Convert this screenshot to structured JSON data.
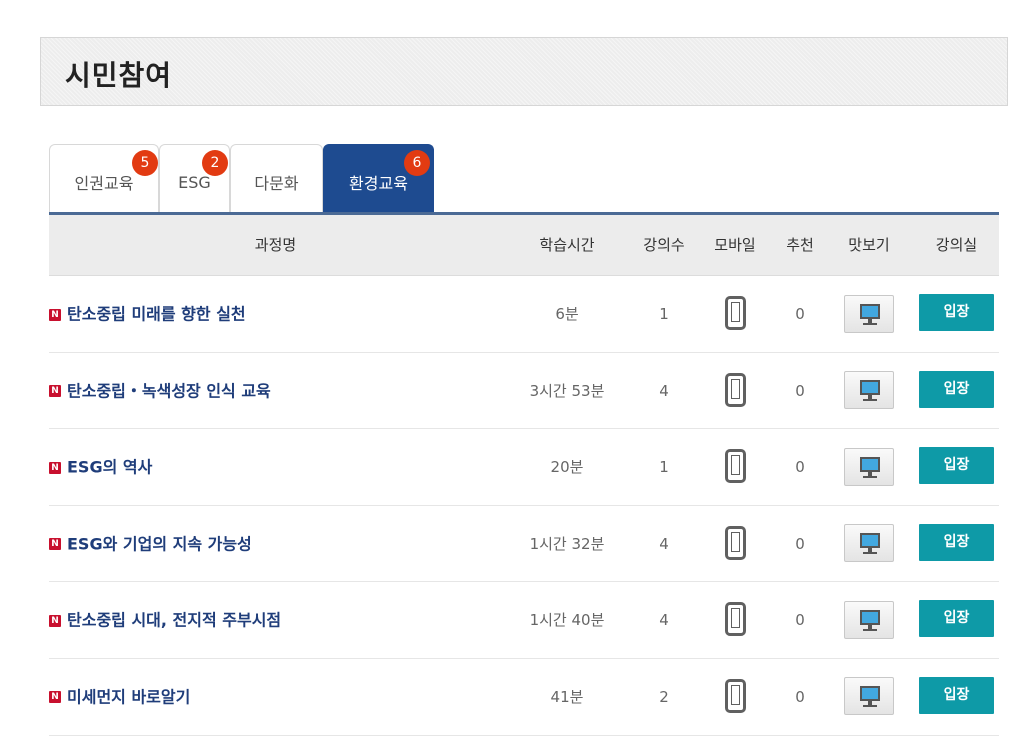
{
  "page": {
    "title": "시민참여"
  },
  "tabs": [
    {
      "label": "인권교육",
      "badge": "5",
      "active": false
    },
    {
      "label": "ESG",
      "badge": "2",
      "active": false
    },
    {
      "label": "다문화",
      "badge": "",
      "active": false
    },
    {
      "label": "환경교육",
      "badge": "6",
      "active": true
    }
  ],
  "table": {
    "headers": {
      "name": "과정명",
      "time": "학습시간",
      "count": "강의수",
      "mobile": "모바일",
      "recommend": "추천",
      "preview": "맛보기",
      "room": "강의실"
    },
    "rows": [
      {
        "new_mark": "N",
        "title": "탄소중립 미래를 향한 실천",
        "time": "6분",
        "count": "1",
        "recommend": "0",
        "enter": "입장"
      },
      {
        "new_mark": "N",
        "title": "탄소중립・녹색성장 인식 교육",
        "time": "3시간 53분",
        "count": "4",
        "recommend": "0",
        "enter": "입장"
      },
      {
        "new_mark": "N",
        "title": "ESG의 역사",
        "time": "20분",
        "count": "1",
        "recommend": "0",
        "enter": "입장"
      },
      {
        "new_mark": "N",
        "title": "ESG와 기업의 지속 가능성",
        "time": "1시간 32분",
        "count": "4",
        "recommend": "0",
        "enter": "입장"
      },
      {
        "new_mark": "N",
        "title": "탄소중립 시대, 전지적 주부시점",
        "time": "1시간 40분",
        "count": "4",
        "recommend": "0",
        "enter": "입장"
      },
      {
        "new_mark": "N",
        "title": "미세먼지 바로알기",
        "time": "41분",
        "count": "2",
        "recommend": "0",
        "enter": "입장"
      }
    ]
  },
  "icons": {
    "mobile": "mobile-phone-icon",
    "preview": "monitor-icon",
    "new": "new-badge-icon"
  },
  "colors": {
    "active_tab": "#1e4b90",
    "badge": "#e23b12",
    "enter_button": "#0e9aa7",
    "course_title": "#1f3d7a",
    "new_icon": "#c8102e"
  }
}
